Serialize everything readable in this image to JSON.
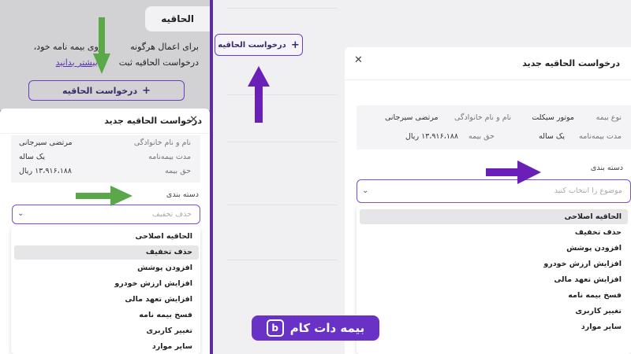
{
  "left": {
    "tab_title": "الحاقیه",
    "info_line1": "برای اعمال هرگونه",
    "info_line1b": "روی بیمه نامه خود،",
    "info_line2": "درخواست الحاقیه ثبت",
    "info_line2b": "بیشتر بدانید",
    "request_button": "درخواست الحاقیه",
    "modal_title": "درخواست الحاقیه جدید",
    "fields": [
      {
        "label": "نام و نام خانوادگی",
        "value": "مرتضی سیرجانی"
      },
      {
        "label": "مدت بیمه‌نامه",
        "value": "یک ساله"
      },
      {
        "label": "حق بیمه",
        "value": "۱۳،۹۱۶،۱۸۸ ریال"
      }
    ],
    "category_label": "دسته بندی",
    "selected_value": "حذف تخفیف",
    "options": [
      "الحاقیه اصلاحی",
      "حذف تخفیف",
      "افزودن پوشش",
      "افزایش ارزش خودرو",
      "افزایش تعهد مالی",
      "فسخ بیمه نامه",
      "تغییر کاربری",
      "سایر موارد"
    ],
    "highlighted_index": 1
  },
  "right": {
    "request_button": "درخواست الحاقیه",
    "modal_title": "درخواست الحاقیه جدید",
    "fields": [
      {
        "label": "نوع بیمه",
        "value": "موتور سیکلت"
      },
      {
        "label": "نام و نام خانوادگی",
        "value": "مرتضی سیرجانی"
      },
      {
        "label": "مدت بیمه‌نامه",
        "value": "یک ساله"
      },
      {
        "label": "حق بیمه",
        "value": "۱۳،۹۱۶،۱۸۸ ریال"
      }
    ],
    "category_label": "دسته بندی",
    "placeholder": "موضوع را انتخاب کنید",
    "options": [
      "الحاقیه اصلاحی",
      "حذف تخفیف",
      "افزودن پوشش",
      "افزایش ارزش خودرو",
      "افزایش تعهد مالی",
      "فسخ بیمه نامه",
      "تغییر کاربری",
      "سایر موارد"
    ],
    "highlighted_index": 0
  },
  "logo": {
    "text": "بیمه دات کام",
    "mark": "b"
  },
  "colors": {
    "accent": "#6b3cc4",
    "arrow_green": "#5aa84a",
    "arrow_purple": "#6a1fb8",
    "divider": "#5b2da0"
  }
}
